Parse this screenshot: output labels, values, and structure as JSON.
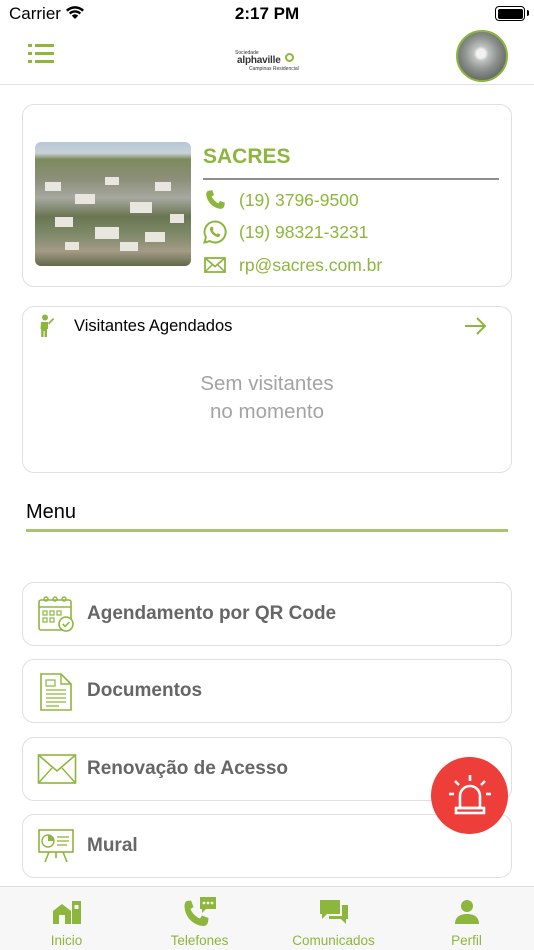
{
  "status_bar": {
    "carrier": "Carrier",
    "time": "2:17 PM"
  },
  "header": {
    "logo": {
      "line1": "Sociedade",
      "line2": "alphaville",
      "line3": "Campinas Residencial"
    }
  },
  "contact": {
    "name": "SACRES",
    "phone": "(19) 3796-9500",
    "whatsapp": "(19) 98321-3231",
    "email": "rp@sacres.com.br"
  },
  "visitors": {
    "title": "Visitantes Agendados",
    "empty_line1": "Sem visitantes",
    "empty_line2": "no momento"
  },
  "menu": {
    "title": "Menu",
    "items": [
      {
        "label": "Agendamento por QR Code",
        "icon": "calendar-check-icon"
      },
      {
        "label": "Documentos",
        "icon": "document-icon"
      },
      {
        "label": "Renovação de Acesso",
        "icon": "envelope-icon"
      },
      {
        "label": "Mural",
        "icon": "presentation-board-icon"
      }
    ]
  },
  "tabs": [
    {
      "label": "Inicio",
      "icon": "home-icon"
    },
    {
      "label": "Telefones",
      "icon": "phone-chat-icon"
    },
    {
      "label": "Comunicados",
      "icon": "chat-bubbles-icon"
    },
    {
      "label": "Perfil",
      "icon": "person-icon"
    }
  ],
  "colors": {
    "accent": "#8db63c",
    "panic": "#ee3e3a",
    "muted_text": "#666666"
  }
}
